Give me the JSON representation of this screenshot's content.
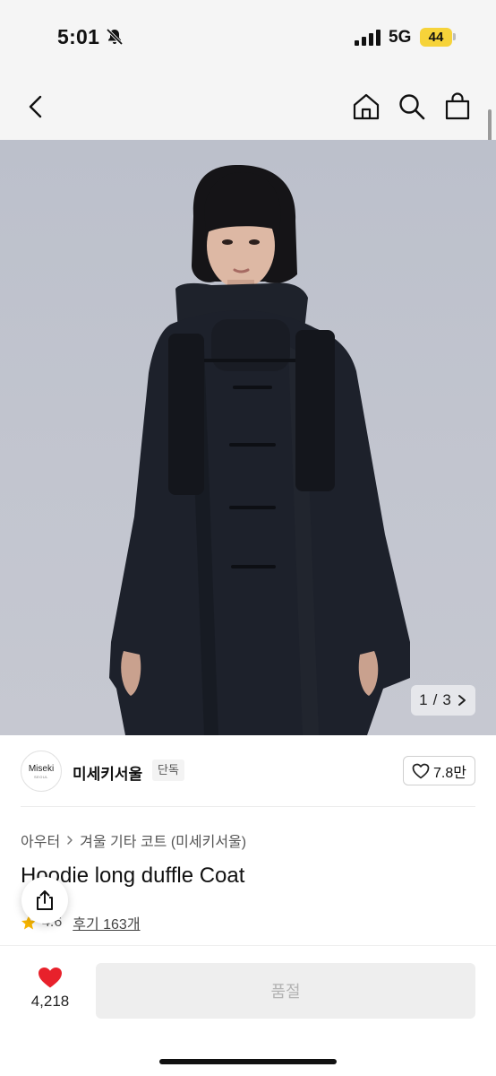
{
  "status_bar": {
    "time": "5:01",
    "network": "5G",
    "battery": "44",
    "icons": [
      "bell-slash-icon",
      "signal-icon"
    ]
  },
  "header": {
    "icons": [
      "back-icon",
      "home-icon",
      "search-icon",
      "shopping-bag-icon"
    ]
  },
  "gallery": {
    "current": "1",
    "total": "3",
    "separator": "/",
    "next_icon": "chevron-right-icon",
    "background": "#c2c5cf"
  },
  "brand": {
    "logo_text": "Miseki",
    "logo_subtext": "SEOUL",
    "name": "미세키서울",
    "badge": "단독",
    "like_count": "7.8만"
  },
  "product": {
    "breadcrumb": [
      "아우터",
      "겨울 기타 코트 (미세키서울)"
    ],
    "title": "Hoodie long duffle Coat",
    "rating": "4.6",
    "reviews": "후기 163개"
  },
  "bottom_bar": {
    "wish_count": "4,218",
    "wish_color": "#e8212b",
    "buy_label": "품절"
  }
}
